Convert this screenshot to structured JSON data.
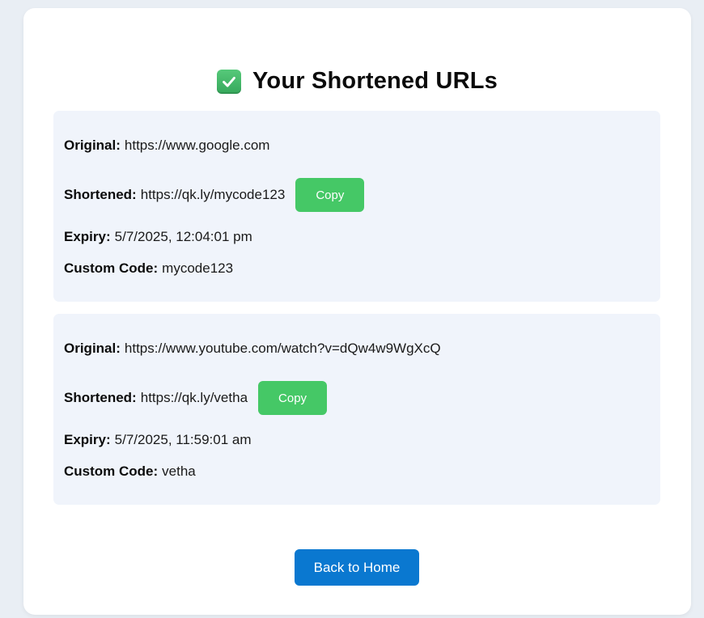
{
  "page": {
    "title": "Your Shortened URLs",
    "title_icon": "check-mark-button-icon"
  },
  "labels": {
    "original": "Original:",
    "shortened": "Shortened:",
    "expiry": "Expiry:",
    "custom_code": "Custom Code:"
  },
  "urls": [
    {
      "original": "https://www.google.com",
      "shortened": "https://qk.ly/mycode123",
      "copy_label": "Copy",
      "expiry": "5/7/2025, 12:04:01 pm",
      "custom_code": "mycode123"
    },
    {
      "original": "https://www.youtube.com/watch?v=dQw4w9WgXcQ",
      "shortened": "https://qk.ly/vetha",
      "copy_label": "Copy",
      "expiry": "5/7/2025, 11:59:01 am",
      "custom_code": "vetha"
    }
  ],
  "back_button_label": "Back to Home",
  "colors": {
    "page_background": "#e9eef4",
    "card_background": "#ffffff",
    "item_background": "#f0f4fb",
    "copy_button": "#45c866",
    "back_button": "#0a78d0"
  }
}
